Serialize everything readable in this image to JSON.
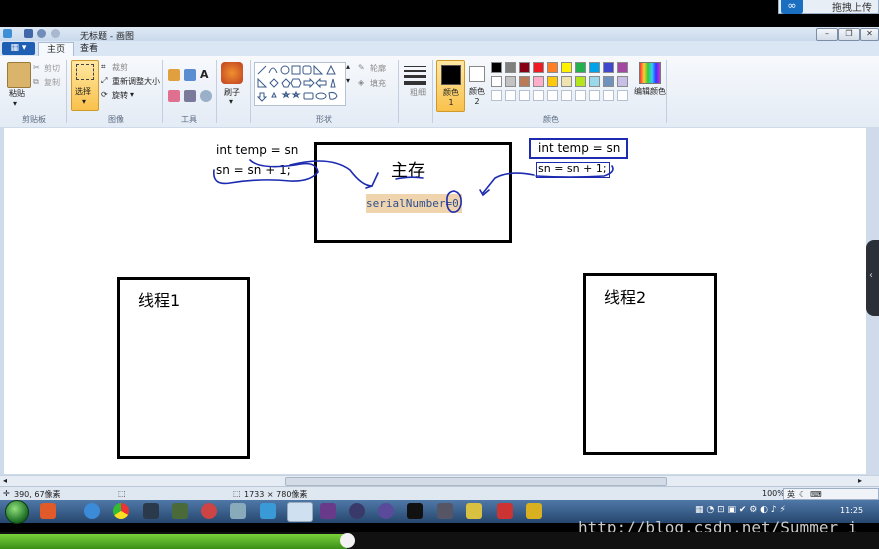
{
  "overlay": {
    "upload_label": "拖拽上传",
    "upload_icon": "cloud-icon"
  },
  "window": {
    "title": "无标题 - 画图"
  },
  "ribbon": {
    "file_tab": "▦ ▾",
    "tabs": [
      "主页",
      "查看"
    ],
    "clipboard": {
      "paste": "粘贴",
      "cut": "剪切",
      "copy": "复制",
      "group": "剪贴板"
    },
    "image": {
      "select": "选择",
      "crop": "裁剪",
      "resize": "重新调整大小",
      "rotate": "旋转",
      "group": "图像"
    },
    "tools": {
      "group": "工具"
    },
    "brushes": {
      "label": "刷子"
    },
    "shapes": {
      "outline": "轮廓",
      "fill": "填充",
      "group": "形状"
    },
    "size": {
      "label": "粗细"
    },
    "colors": {
      "color1": "颜色 1",
      "color2": "颜色 2",
      "edit": "编辑颜色",
      "group": "颜色",
      "palette_row1": [
        "#000000",
        "#7f7f7f",
        "#880015",
        "#ed1c24",
        "#ff7f27",
        "#fff200",
        "#22b14c",
        "#00a2e8",
        "#3f48cc",
        "#a349a4"
      ],
      "palette_row2": [
        "#ffffff",
        "#c3c3c3",
        "#b97a57",
        "#ffaec9",
        "#ffc90e",
        "#efe4b0",
        "#b5e61d",
        "#99d9ea",
        "#7092be",
        "#c8bfe7"
      ]
    }
  },
  "drawing": {
    "left_code_1": "int temp = sn",
    "left_code_2": "sn = sn + 1;",
    "main_memory_title": "主存",
    "serial_number": "serialNumber=0",
    "right_code_1": "int temp = sn",
    "right_code_2": "sn = sn + 1;",
    "thread1": "线程1",
    "thread2": "线程2"
  },
  "status": {
    "cursor_pos": "390, 67像素",
    "canvas_size": "1733 × 780像素",
    "zoom": "100%"
  },
  "taskbar": {
    "clock": "11:25",
    "ime": "英"
  },
  "watermark": "http://blog.csdn.net/Summer_i",
  "video": {
    "progress": 0.395
  }
}
